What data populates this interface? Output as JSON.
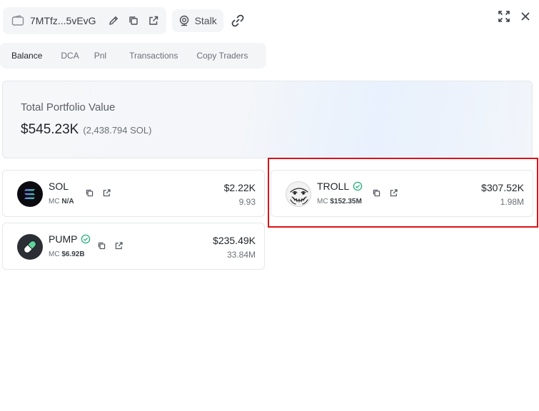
{
  "header": {
    "wallet_address": "7MTfz...5vEvG",
    "stalk_label": "Stalk"
  },
  "tabs": [
    {
      "label": "Balance",
      "active": true
    },
    {
      "label": "DCA",
      "active": false
    },
    {
      "label": "Pnl",
      "active": false
    },
    {
      "label": "Transactions",
      "active": false
    },
    {
      "label": "Copy Traders",
      "active": false
    }
  ],
  "portfolio": {
    "label": "Total Portfolio Value",
    "value": "$545.23K",
    "sol": "(2,438.794 SOL)"
  },
  "tokens": [
    {
      "name": "SOL",
      "mc_label": "MC",
      "mc": "N/A",
      "value": "$2.22K",
      "amount": "9.93",
      "verified": false
    },
    {
      "name": "TROLL",
      "mc_label": "MC",
      "mc": "$152.35M",
      "value": "$307.52K",
      "amount": "1.98M",
      "verified": true
    },
    {
      "name": "PUMP",
      "mc_label": "MC",
      "mc": "$6.92B",
      "value": "$235.49K",
      "amount": "33.84M",
      "verified": true
    }
  ],
  "colors": {
    "verified": "#22b07d",
    "highlight": "#d9141a",
    "tab_bg": "#f4f5f7"
  }
}
